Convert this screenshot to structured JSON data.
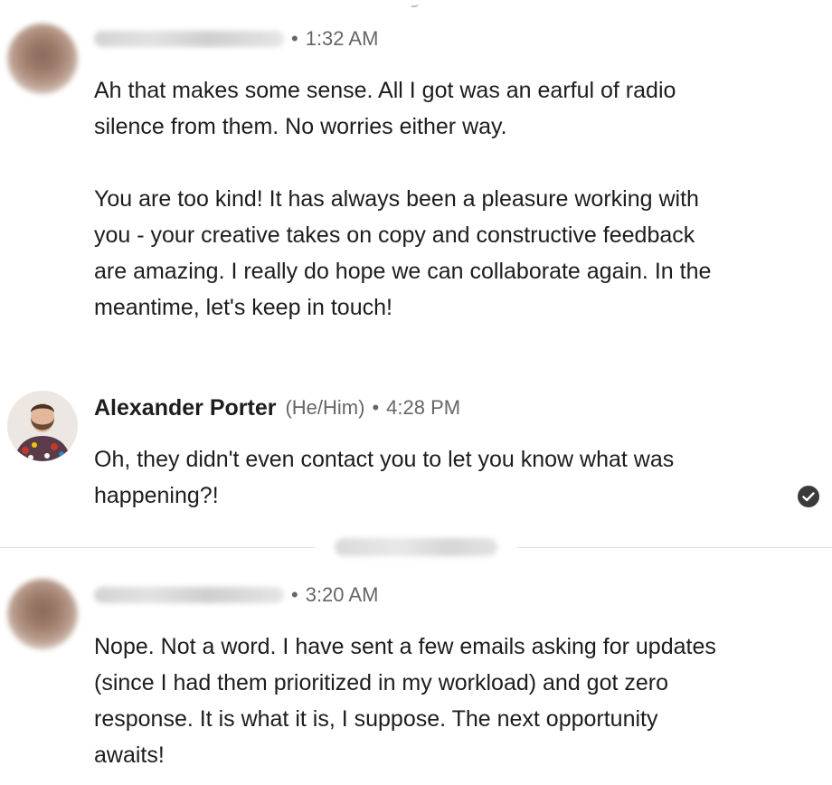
{
  "thread": {
    "messages": [
      {
        "sender": "",
        "time": "1:32 AM",
        "paragraphs": [
          "Ah that makes some sense. All I got was an earful of radio silence from them. No worries either way.",
          "You are too kind! It has always been a pleasure working with you - your creative takes on copy and constructive feedback are amazing. I really do hope we can collaborate again. In the meantime, let's keep in touch!"
        ]
      },
      {
        "sender": "Alexander Porter",
        "pronouns": "(He/Him)",
        "time": "4:28 PM",
        "paragraphs": [
          "Oh, they didn't even contact you to let you know what was happening?!"
        ],
        "read_receipt_icon": "check-circle-icon"
      },
      {
        "sender": "",
        "time": "3:20 AM",
        "paragraphs": [
          "Nope. Not a word. I have sent a few emails asking for updates (since I had them prioritized in my workload) and got zero response. It is what it is, I suppose. The next opportunity awaits!"
        ]
      }
    ],
    "separator": "•",
    "colors": {
      "text": "#1d1d1f",
      "meta": "#666666",
      "divider": "#dcdcdc",
      "read_icon": "#3a3a3a"
    }
  }
}
